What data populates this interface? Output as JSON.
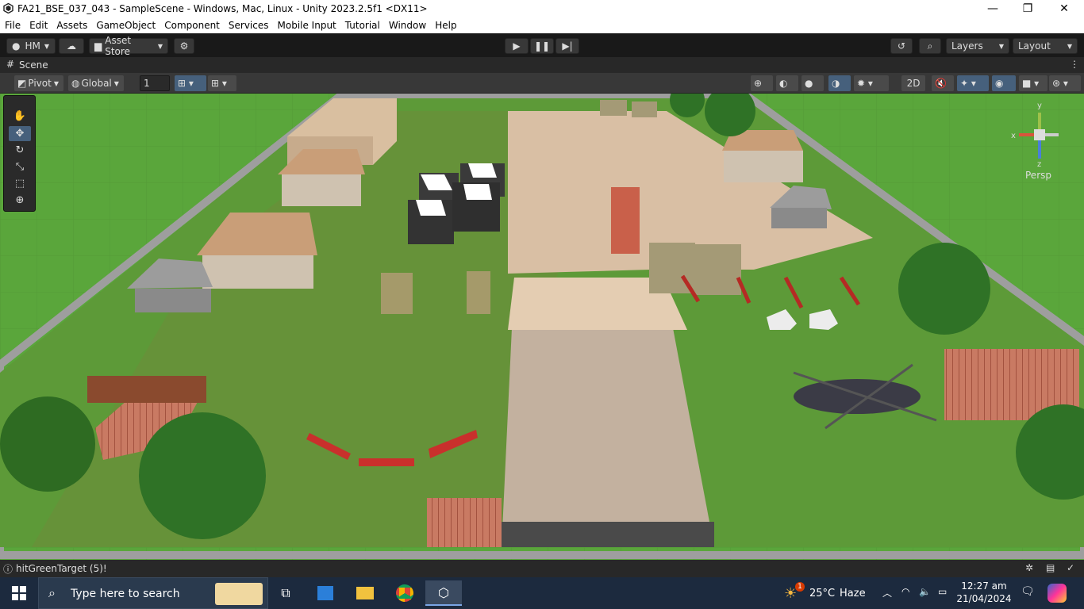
{
  "window": {
    "title": "FA21_BSE_037_043 - SampleScene - Windows, Mac, Linux - Unity 2023.2.5f1 <DX11>",
    "minimize": "—",
    "maximize": "❐",
    "close": "✕"
  },
  "menu": [
    "File",
    "Edit",
    "Assets",
    "GameObject",
    "Component",
    "Services",
    "Mobile Input",
    "Tutorial",
    "Window",
    "Help"
  ],
  "toolbar": {
    "account": "HM",
    "asset_store": "Asset Store",
    "layers": "Layers",
    "layout": "Layout"
  },
  "scene": {
    "tab_label": "Scene",
    "pivot": "Pivot",
    "global": "Global",
    "grid_value": "1",
    "mode_2d": "2D",
    "persp": "Persp"
  },
  "console": {
    "message": "hitGreenTarget (5)!"
  },
  "taskbar": {
    "search_placeholder": "Type here to search",
    "weather_temp": "25°C",
    "weather_desc": "Haze",
    "weather_badge": "1",
    "time": "12:27 am",
    "date": "21/04/2024"
  },
  "colors": {
    "editor_bg": "#191919",
    "panel": "#383838",
    "grass": "#57a23a",
    "ground": "#d7bca2",
    "taskbar": "#1c2a3e"
  }
}
